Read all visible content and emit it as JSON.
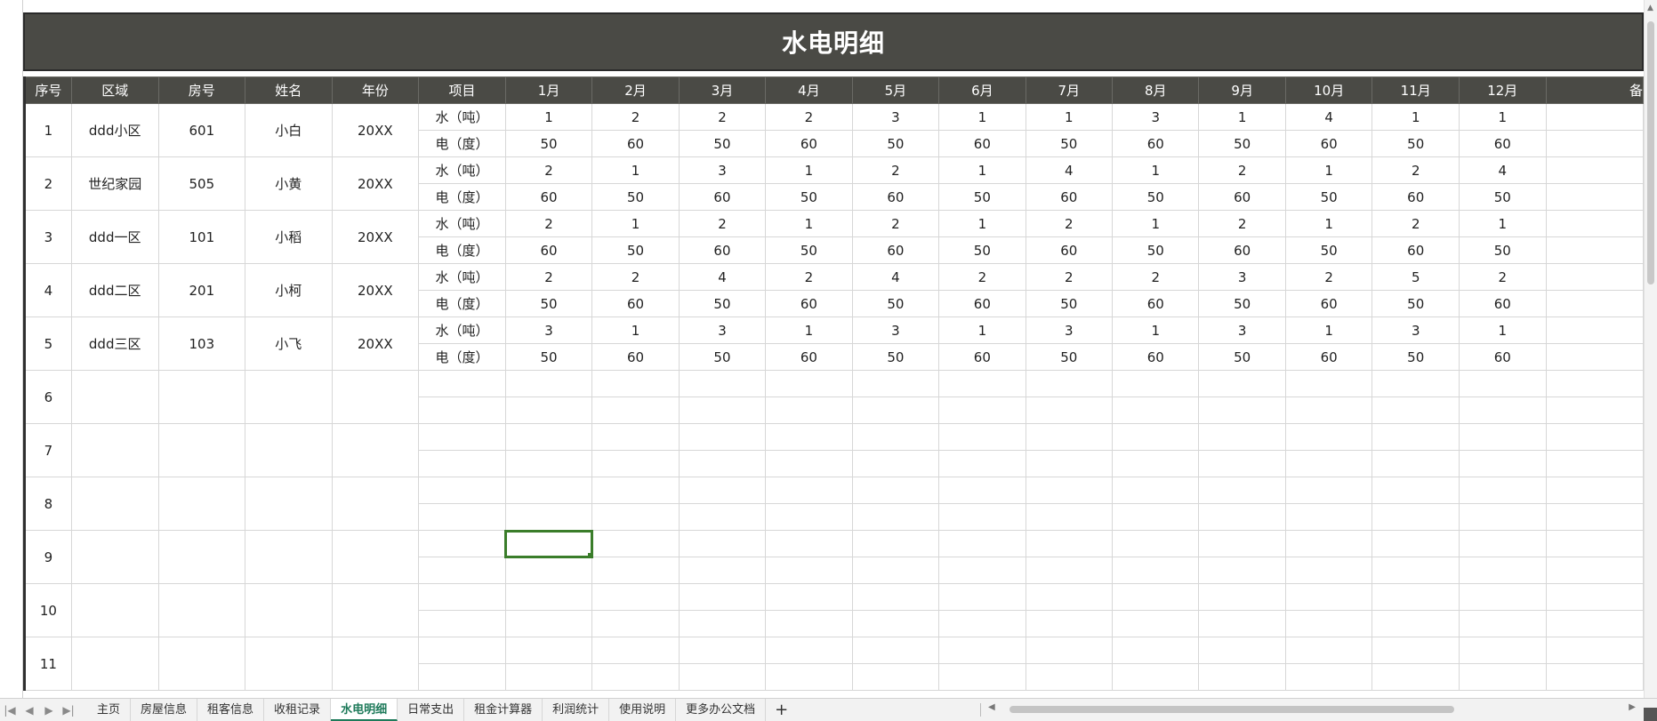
{
  "title": "水电明细",
  "headers": [
    "序号",
    "区域",
    "房号",
    "姓名",
    "年份",
    "项目",
    "1月",
    "2月",
    "3月",
    "4月",
    "5月",
    "6月",
    "7月",
    "8月",
    "9月",
    "10月",
    "11月",
    "12月",
    "备"
  ],
  "records": [
    {
      "no": "1",
      "area": "ddd小区",
      "room": "601",
      "name": "小白",
      "year": "20XX",
      "water_label": "水（吨）",
      "elec_label": "电（度）",
      "water": [
        "1",
        "2",
        "2",
        "2",
        "3",
        "1",
        "1",
        "3",
        "1",
        "4",
        "1",
        "1"
      ],
      "elec": [
        "50",
        "60",
        "50",
        "60",
        "50",
        "60",
        "50",
        "60",
        "50",
        "60",
        "50",
        "60"
      ]
    },
    {
      "no": "2",
      "area": "世纪家园",
      "room": "505",
      "name": "小黄",
      "year": "20XX",
      "water_label": "水（吨）",
      "elec_label": "电（度）",
      "water": [
        "2",
        "1",
        "3",
        "1",
        "2",
        "1",
        "4",
        "1",
        "2",
        "1",
        "2",
        "4"
      ],
      "elec": [
        "60",
        "50",
        "60",
        "50",
        "60",
        "50",
        "60",
        "50",
        "60",
        "50",
        "60",
        "50"
      ]
    },
    {
      "no": "3",
      "area": "ddd一区",
      "room": "101",
      "name": "小稻",
      "year": "20XX",
      "water_label": "水（吨）",
      "elec_label": "电（度）",
      "water": [
        "2",
        "1",
        "2",
        "1",
        "2",
        "1",
        "2",
        "1",
        "2",
        "1",
        "2",
        "1"
      ],
      "elec": [
        "60",
        "50",
        "60",
        "50",
        "60",
        "50",
        "60",
        "50",
        "60",
        "50",
        "60",
        "50"
      ]
    },
    {
      "no": "4",
      "area": "ddd二区",
      "room": "201",
      "name": "小柯",
      "year": "20XX",
      "water_label": "水（吨）",
      "elec_label": "电（度）",
      "water": [
        "2",
        "2",
        "4",
        "2",
        "4",
        "2",
        "2",
        "2",
        "3",
        "2",
        "5",
        "2"
      ],
      "elec": [
        "50",
        "60",
        "50",
        "60",
        "50",
        "60",
        "50",
        "60",
        "50",
        "60",
        "50",
        "60"
      ]
    },
    {
      "no": "5",
      "area": "ddd三区",
      "room": "103",
      "name": "小飞",
      "year": "20XX",
      "water_label": "水（吨）",
      "elec_label": "电（度）",
      "water": [
        "3",
        "1",
        "3",
        "1",
        "3",
        "1",
        "3",
        "1",
        "3",
        "1",
        "3",
        "1"
      ],
      "elec": [
        "50",
        "60",
        "50",
        "60",
        "50",
        "60",
        "50",
        "60",
        "50",
        "60",
        "50",
        "60"
      ]
    }
  ],
  "empty_row_numbers": [
    "6",
    "7",
    "8",
    "9",
    "10",
    "11"
  ],
  "tabs": [
    "主页",
    "房屋信息",
    "租客信息",
    "收租记录",
    "水电明细",
    "日常支出",
    "租金计算器",
    "利润统计",
    "使用说明",
    "更多办公文档"
  ],
  "active_tab": "水电明细",
  "colors": {
    "header_bg": "#4a4a45",
    "active_tab": "#1e7a5a",
    "selection": "#3a7d2a"
  },
  "icons": {
    "first": "first-sheet-icon",
    "prev": "prev-sheet-icon",
    "next": "next-sheet-icon",
    "last": "last-sheet-icon",
    "add": "add-sheet-icon"
  }
}
